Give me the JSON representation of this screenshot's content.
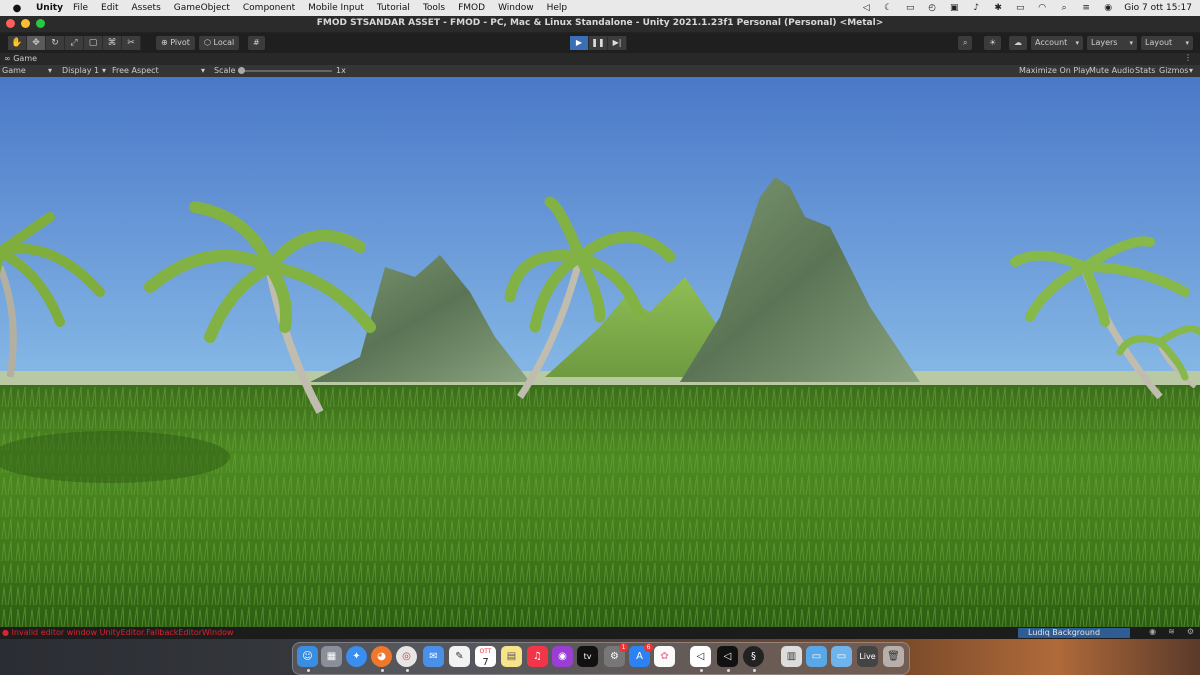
{
  "menubar": {
    "app_name": "Unity",
    "items": [
      "File",
      "Edit",
      "Assets",
      "GameObject",
      "Component",
      "Mobile Input",
      "Tutorial",
      "Tools",
      "FMOD",
      "Window",
      "Help"
    ],
    "clock": "Gio 7 ott  15:17"
  },
  "window": {
    "title": "FMOD STSANDAR ASSET - FMOD - PC, Mac & Linux Standalone - Unity 2021.1.23f1 Personal (Personal) <Metal>"
  },
  "toolbar": {
    "pivot_label": "Pivot",
    "local_label": "Local",
    "account_label": "Account",
    "layers_label": "Layers",
    "layout_label": "Layout"
  },
  "game_tab": {
    "label": "Game"
  },
  "game_bar": {
    "mode": "Game",
    "display": "Display 1",
    "aspect": "Free Aspect",
    "scale_label": "Scale",
    "scale_value": "1x",
    "maximize_label": "Maximize On Play",
    "mute_label": "Mute Audio",
    "stats_label": "Stats",
    "gizmos_label": "Gizmos"
  },
  "status": {
    "error_text": "Invalid editor window UnityEditor.FallbackEditorWindow",
    "worker_text": "Ludiq Background Worker"
  },
  "dock": {
    "calendar_month": "OTT",
    "calendar_day": "7",
    "tv_label": "tv",
    "live_label": "Live",
    "badge_1": "1",
    "badge_2": "6"
  },
  "colors": {
    "sky_top": "#4a78c8",
    "sky_bottom": "#bfe2f0",
    "grass": "#3f7a1a",
    "play_accent": "#3b6fb3",
    "error_red": "#dd2233",
    "worker_blue": "#2f5d93"
  }
}
